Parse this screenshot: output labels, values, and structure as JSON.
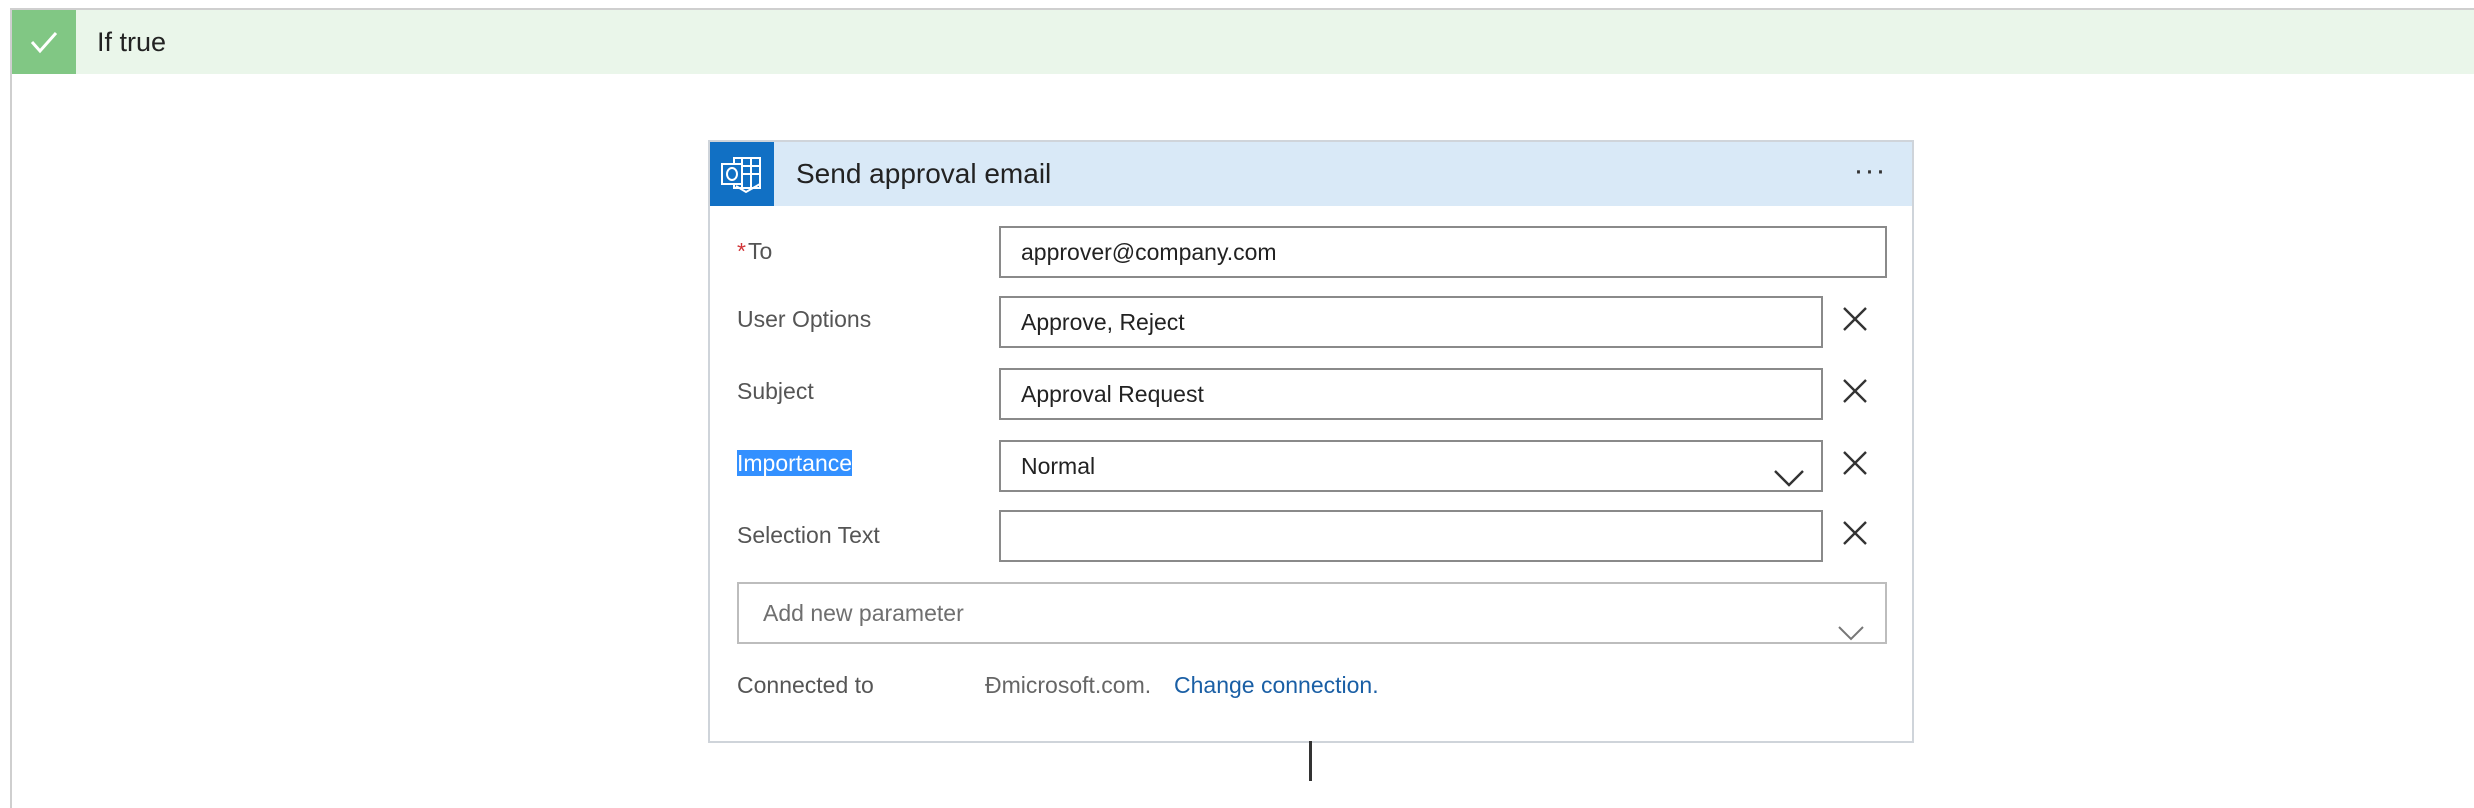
{
  "branch": {
    "title": "If true",
    "header_color": "#eaf6ea",
    "check_color": "#81c784",
    "icon": "checkmark-icon"
  },
  "action": {
    "title": "Send approval email",
    "icon": "outlook-icon",
    "menu_label": "···",
    "accent": "#1170c4",
    "header_color": "#d9e9f7"
  },
  "fields": {
    "to": {
      "required_mark": "*",
      "label": "To",
      "value": "approver@company.com"
    },
    "user_options": {
      "label": "User Options",
      "value": "Approve, Reject"
    },
    "subject": {
      "label": "Subject",
      "value": "Approval Request"
    },
    "importance": {
      "label": "Importance",
      "value": "Normal"
    },
    "selection_text": {
      "label": "Selection Text",
      "value": ""
    }
  },
  "add_parameter": {
    "placeholder": "Add new parameter"
  },
  "connection": {
    "label": "Connected to",
    "account": "Đmicrosoft.com.",
    "change_link": "Change connection."
  }
}
